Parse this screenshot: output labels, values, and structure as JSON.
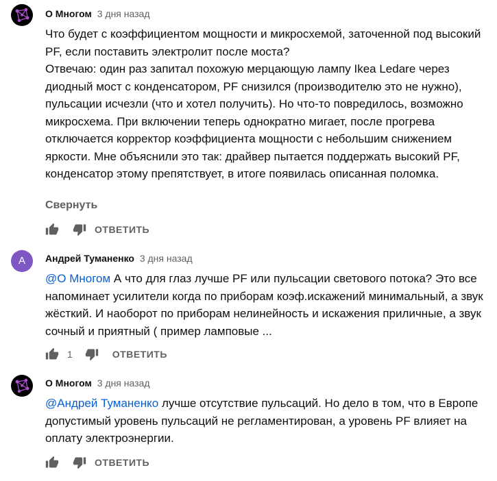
{
  "comments": [
    {
      "author": "О Многом",
      "time": "3 дня назад",
      "paragraphs": [
        "Что будет с коэффициентом мощности и микросхемой, заточенной под высокий PF, если поставить электролит после моста?",
        "Отвечаю: один раз запитал похожую мерцающую лампу Ikea Ledare через диодный мост с конденсатором, PF снизился (производителю это не нужно), пульсации исчезли (что и хотел получить). Но что-то повредилось, возможно микросхема. При включении теперь однократно мигает, после прогрева отключается корректор коэффициента мощности с небольшим снижением яркости. Мне объяснили это так: драйвер пытается поддержать высокий PF, конденсатор этому препятствует, в итоге появилась описанная поломка."
      ],
      "collapse_label": "Свернуть",
      "reply_label": "ОТВЕТИТЬ"
    },
    {
      "author": "Андрей Туманенко",
      "avatar_letter": "A",
      "time": "3 дня назад",
      "mention": "@О Многом",
      "text": " А что для глаз лучше PF или пульсации светового потока? Это все напоминает усилители когда по приборам коэф.искажений минимальный, а звук жёсткий. И наоборот по приборам нелинейность и искажения приличные, а звук сочный и приятный ( пример ламповые ...",
      "like_count": "1",
      "reply_label": "ОТВЕТИТЬ"
    },
    {
      "author": "О Многом",
      "time": "3 дня назад",
      "mention": "@Андрей Туманенко",
      "text": " лучше отсутствие пульсаций. Но дело в том, что в Европе допустимый уровень пульсаций не регламентирован, а уровень PF влияет на оплату электроэнергии.",
      "reply_label": "ОТВЕТИТЬ"
    }
  ],
  "colors": {
    "text": "#0f0f0f",
    "secondary": "#606060",
    "link": "#065fd4",
    "avatar_letter_bg": "#7e57c2",
    "avatar_logo_bg": "#000000",
    "avatar_logo_accent": "#b04fd6"
  },
  "icons": {
    "like": "thumb-up-icon",
    "dislike": "thumb-down-icon",
    "channel_logo": "network-logo-icon"
  }
}
